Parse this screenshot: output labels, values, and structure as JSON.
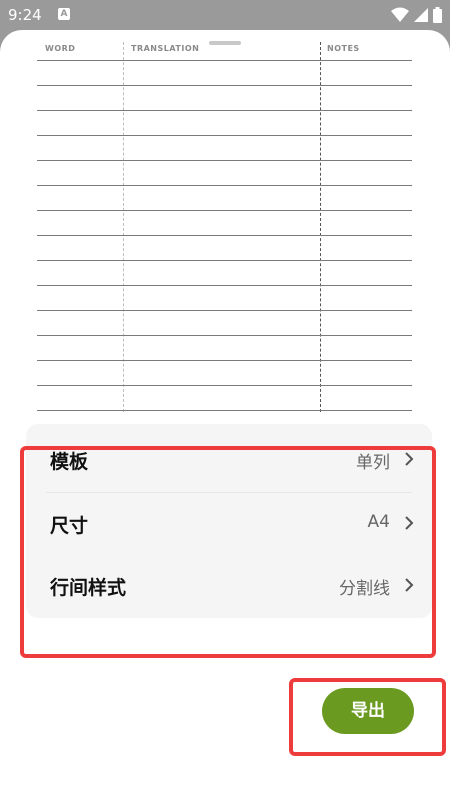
{
  "status_bar": {
    "time": "9:24",
    "notification_icon": "a-icon",
    "a_glyph": "A",
    "wifi_icon": "wifi-icon",
    "signal_icon": "signal-icon",
    "battery_icon": "battery-icon"
  },
  "preview": {
    "columns": [
      "WORD",
      "TRANSLATION",
      "NOTES"
    ]
  },
  "settings": {
    "rows": [
      {
        "label": "模板",
        "value": "单列"
      },
      {
        "label": "尺寸",
        "value": "A4"
      },
      {
        "label": "行间样式",
        "value": "分割线"
      }
    ]
  },
  "actions": {
    "export_label": "导出"
  },
  "colors": {
    "accent": "#6a9a20",
    "annotation": "#ee3b3b",
    "panel_bg": "#f5f5f5"
  }
}
